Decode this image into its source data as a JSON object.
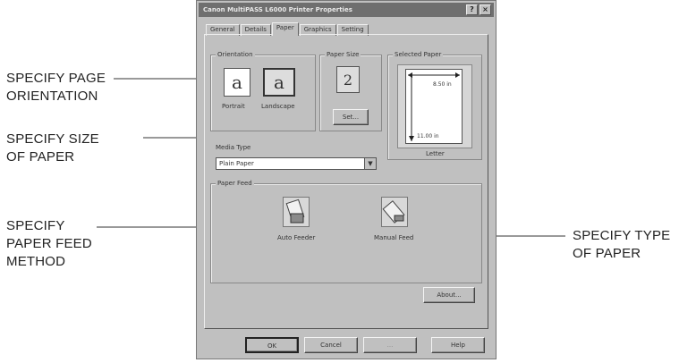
{
  "callouts": {
    "orientation": [
      "SPECIFY PAGE",
      "ORIENTATION"
    ],
    "size": [
      "SPECIFY SIZE",
      "OF PAPER"
    ],
    "type": [
      "SPECIFY TYPE",
      "OF PAPER"
    ],
    "feed": [
      "SPECIFY",
      "PAPER FEED",
      "METHOD"
    ]
  },
  "dialog": {
    "title": "Canon MultiPASS L6000 Printer Properties",
    "title_buttons": [
      "?",
      "×"
    ],
    "tabs": [
      "General",
      "Details",
      "Paper",
      "Graphics",
      "Setting"
    ],
    "active_tab": "Paper",
    "orientation": {
      "group_label": "Orientation",
      "portrait_label": "Portrait",
      "landscape_label": "Landscape",
      "selected": "landscape"
    },
    "paper_size": {
      "group_label": "Paper Size",
      "set_button": "Set..."
    },
    "selected_paper": {
      "group_label": "Selected Paper",
      "width": "8.50 in",
      "height": "11.00 in",
      "name": "Letter"
    },
    "media_type": {
      "label": "Media Type",
      "value": "Plain Paper"
    },
    "paper_feed": {
      "group_label": "Paper Feed",
      "auto_label": "Auto Feeder",
      "manual_label": "Manual Feed"
    },
    "about_button": "About...",
    "footer_buttons": {
      "ok": "OK",
      "cancel": "Cancel",
      "apply": "...",
      "help": "Help"
    }
  }
}
